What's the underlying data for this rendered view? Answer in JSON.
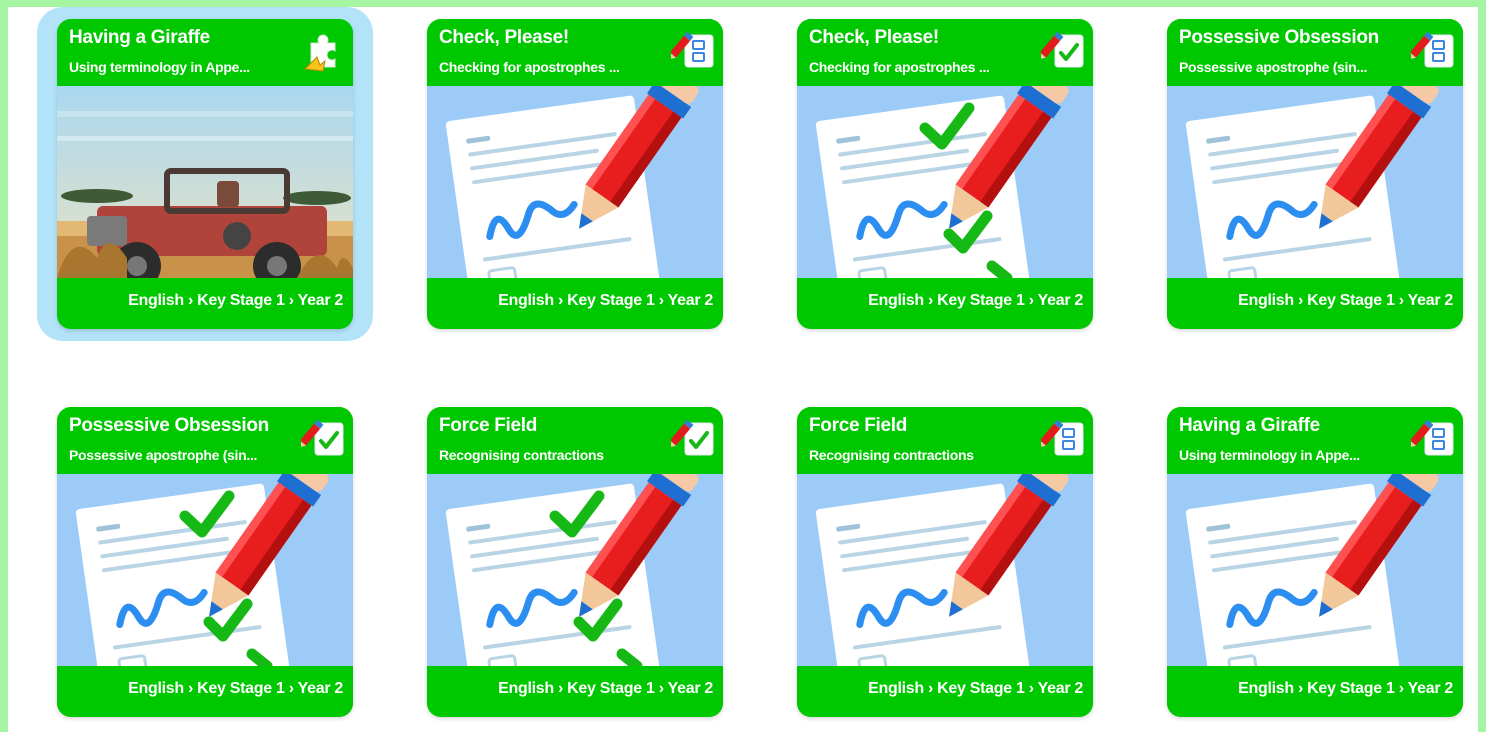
{
  "cards": [
    {
      "title": "Having a Giraffe",
      "subtitle": "Using terminology in Appe...",
      "subject": "English",
      "key_stage": "Key Stage 1",
      "year": "Year 2",
      "type_icon": "puzzle-icon",
      "image": "safari-jeep",
      "selected": true
    },
    {
      "title": "Check, Please!",
      "subtitle": "Checking for apostrophes ...",
      "subject": "English",
      "key_stage": "Key Stage 1",
      "year": "Year 2",
      "type_icon": "pencil-list-icon",
      "image": "worksheet"
    },
    {
      "title": "Check, Please!",
      "subtitle": "Checking for apostrophes ...",
      "subject": "English",
      "key_stage": "Key Stage 1",
      "year": "Year 2",
      "type_icon": "pencil-check-icon",
      "image": "worksheet-ticks"
    },
    {
      "title": "Possessive Obsession",
      "subtitle": "Possessive apostrophe (sin...",
      "subject": "English",
      "key_stage": "Key Stage 1",
      "year": "Year 2",
      "type_icon": "pencil-list-icon",
      "image": "worksheet"
    },
    {
      "title": "Possessive Obsession",
      "subtitle": "Possessive apostrophe (sin...",
      "subject": "English",
      "key_stage": "Key Stage 1",
      "year": "Year 2",
      "type_icon": "pencil-check-icon",
      "image": "worksheet-ticks"
    },
    {
      "title": "Force Field",
      "subtitle": "Recognising contractions",
      "subject": "English",
      "key_stage": "Key Stage 1",
      "year": "Year 2",
      "type_icon": "pencil-check-icon",
      "image": "worksheet-ticks"
    },
    {
      "title": "Force Field",
      "subtitle": "Recognising contractions",
      "subject": "English",
      "key_stage": "Key Stage 1",
      "year": "Year 2",
      "type_icon": "pencil-list-icon",
      "image": "worksheet"
    },
    {
      "title": "Having a Giraffe",
      "subtitle": "Using terminology in Appe...",
      "subject": "English",
      "key_stage": "Key Stage 1",
      "year": "Year 2",
      "type_icon": "pencil-list-icon",
      "image": "worksheet"
    }
  ],
  "crumb_separator": "›",
  "colors": {
    "card_green": "#00c800",
    "page_border": "#a6f5a3",
    "selected_bg": "#b2e3f8",
    "image_bg": "#9ccbf8"
  }
}
